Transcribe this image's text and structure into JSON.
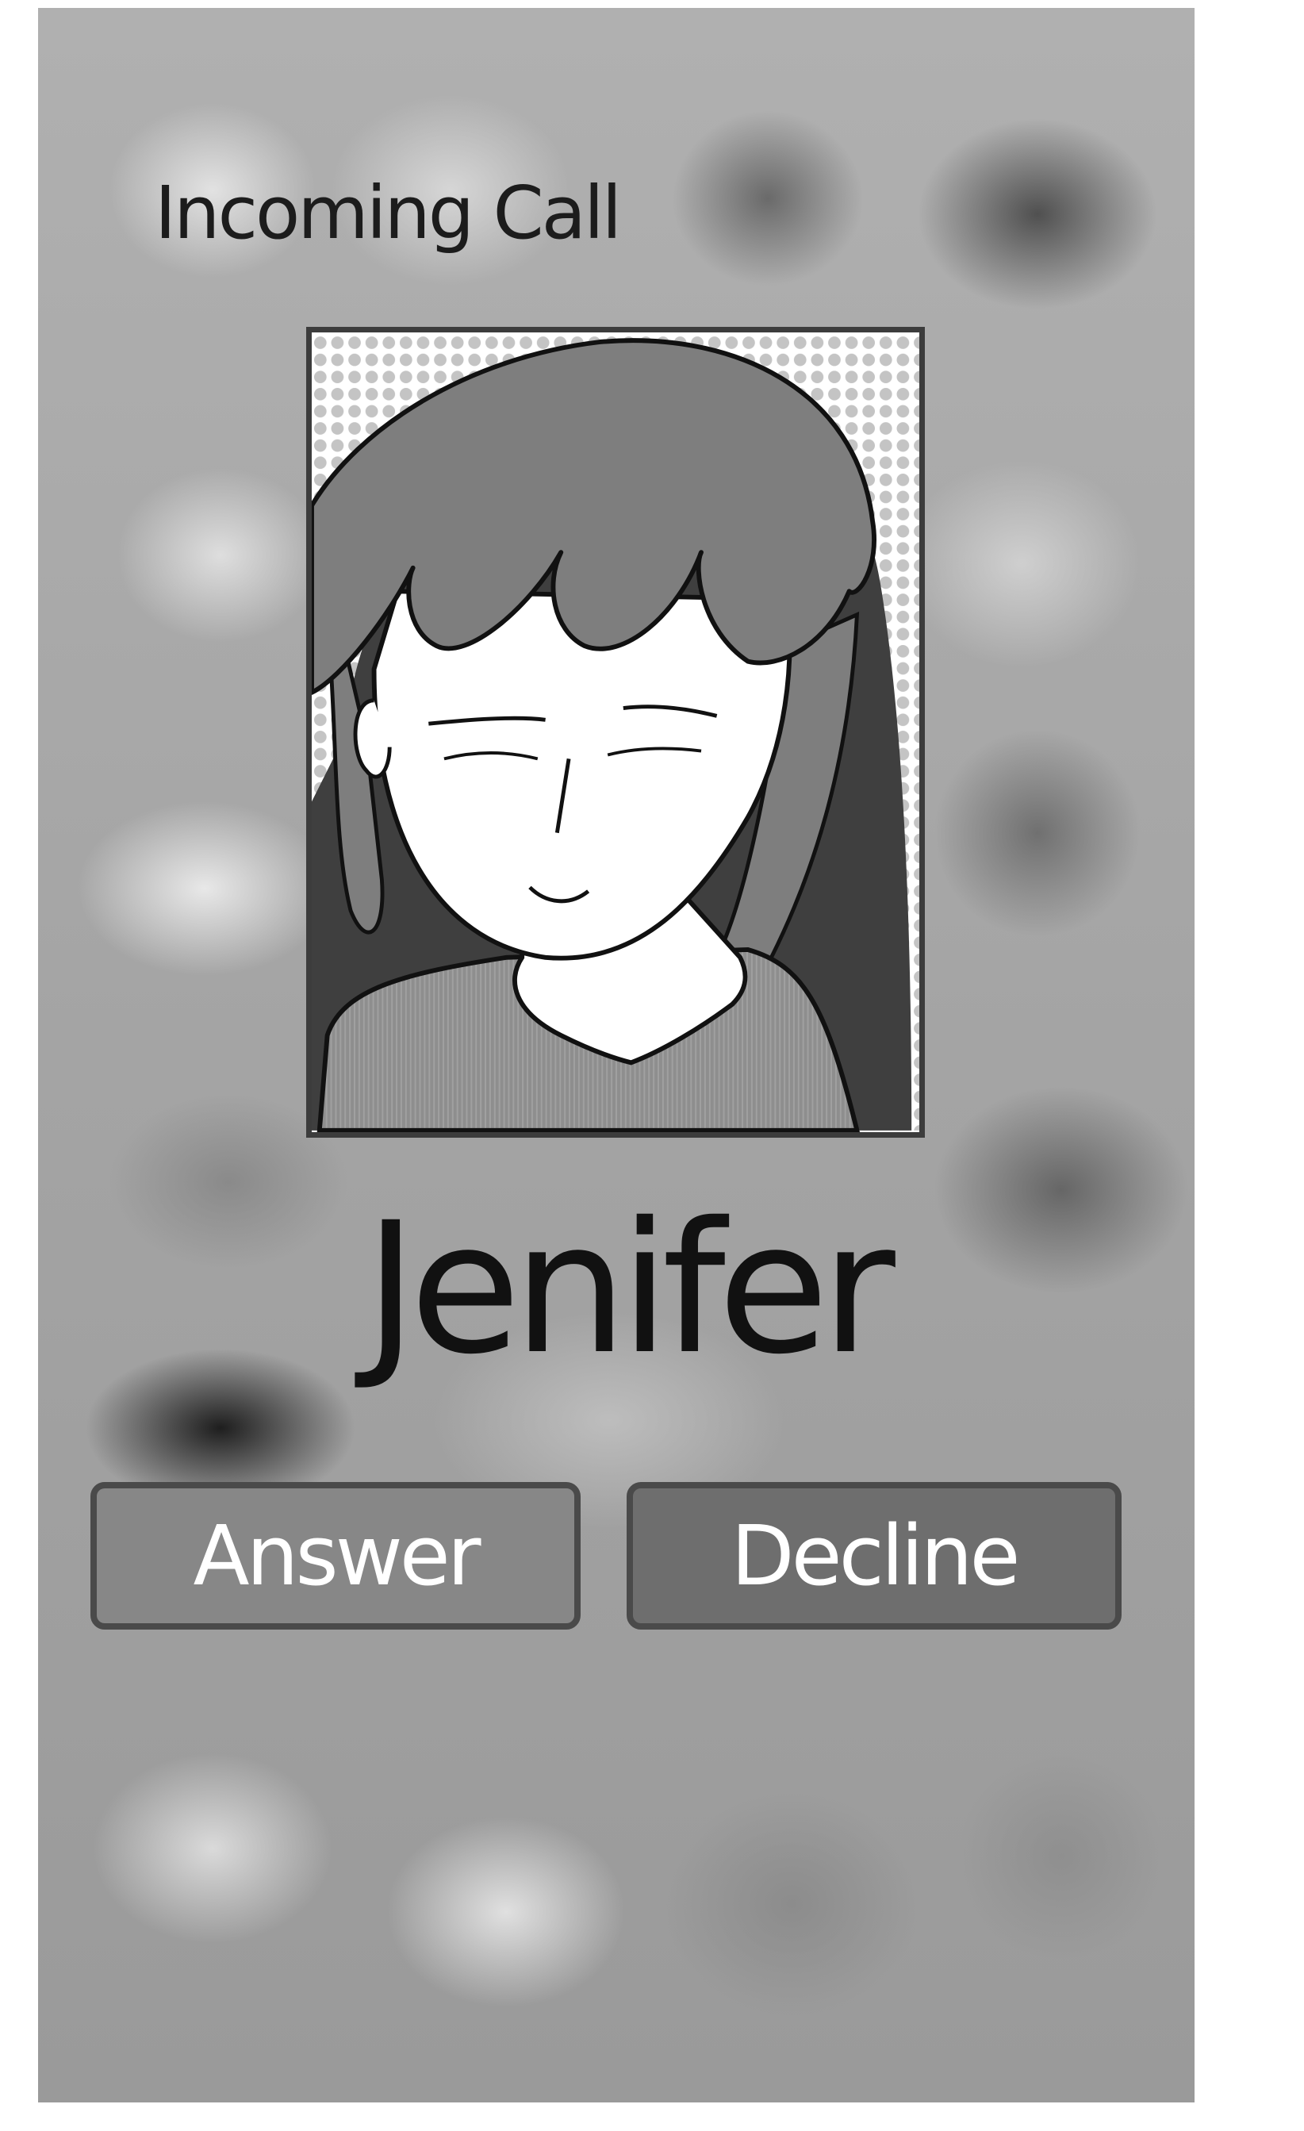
{
  "call_screen": {
    "label": "Incoming Call",
    "caller_name": "Jenifer",
    "answer_label": "Answer",
    "decline_label": "Decline"
  },
  "colors": {
    "background": "#a8a8a8",
    "frame_border": "#3c3c3c",
    "answer_button": "#878787",
    "decline_button": "#6e6e6e",
    "button_text": "#ffffff",
    "text_dark": "#111111"
  },
  "icons": {
    "caller_photo": "caller-portrait-illustration"
  }
}
